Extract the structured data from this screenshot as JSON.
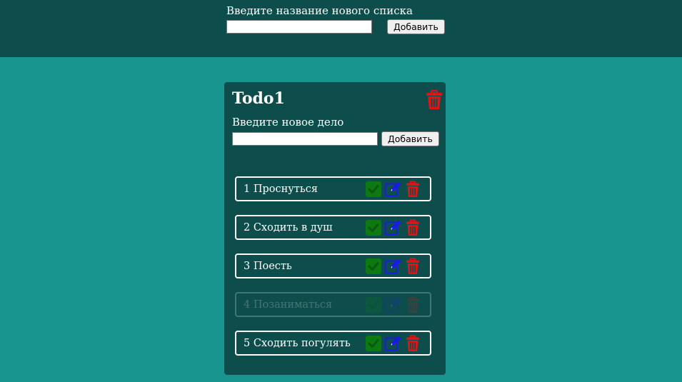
{
  "header": {
    "label": "Введите название нового списка",
    "input_value": "",
    "add_label": "Добавить"
  },
  "card": {
    "title": "Todo1",
    "new_task_label": "Введите новое дело",
    "input_value": "",
    "add_label": "Добавить"
  },
  "tasks": [
    {
      "text": "1 Проснуться",
      "done": false
    },
    {
      "text": "2 Сходить в душ",
      "done": false
    },
    {
      "text": "3 Поесть",
      "done": false
    },
    {
      "text": "4 Позаниматься",
      "done": true
    },
    {
      "text": "5 Сходить погулять",
      "done": false
    }
  ],
  "icons": {
    "complete": "check-icon",
    "edit": "edit-icon",
    "delete": "trash-icon"
  },
  "colors": {
    "background": "#19958f",
    "panel": "#0d4e4c",
    "check": "#0c7a10",
    "edit": "#1a1ae6",
    "delete": "#e01414"
  }
}
